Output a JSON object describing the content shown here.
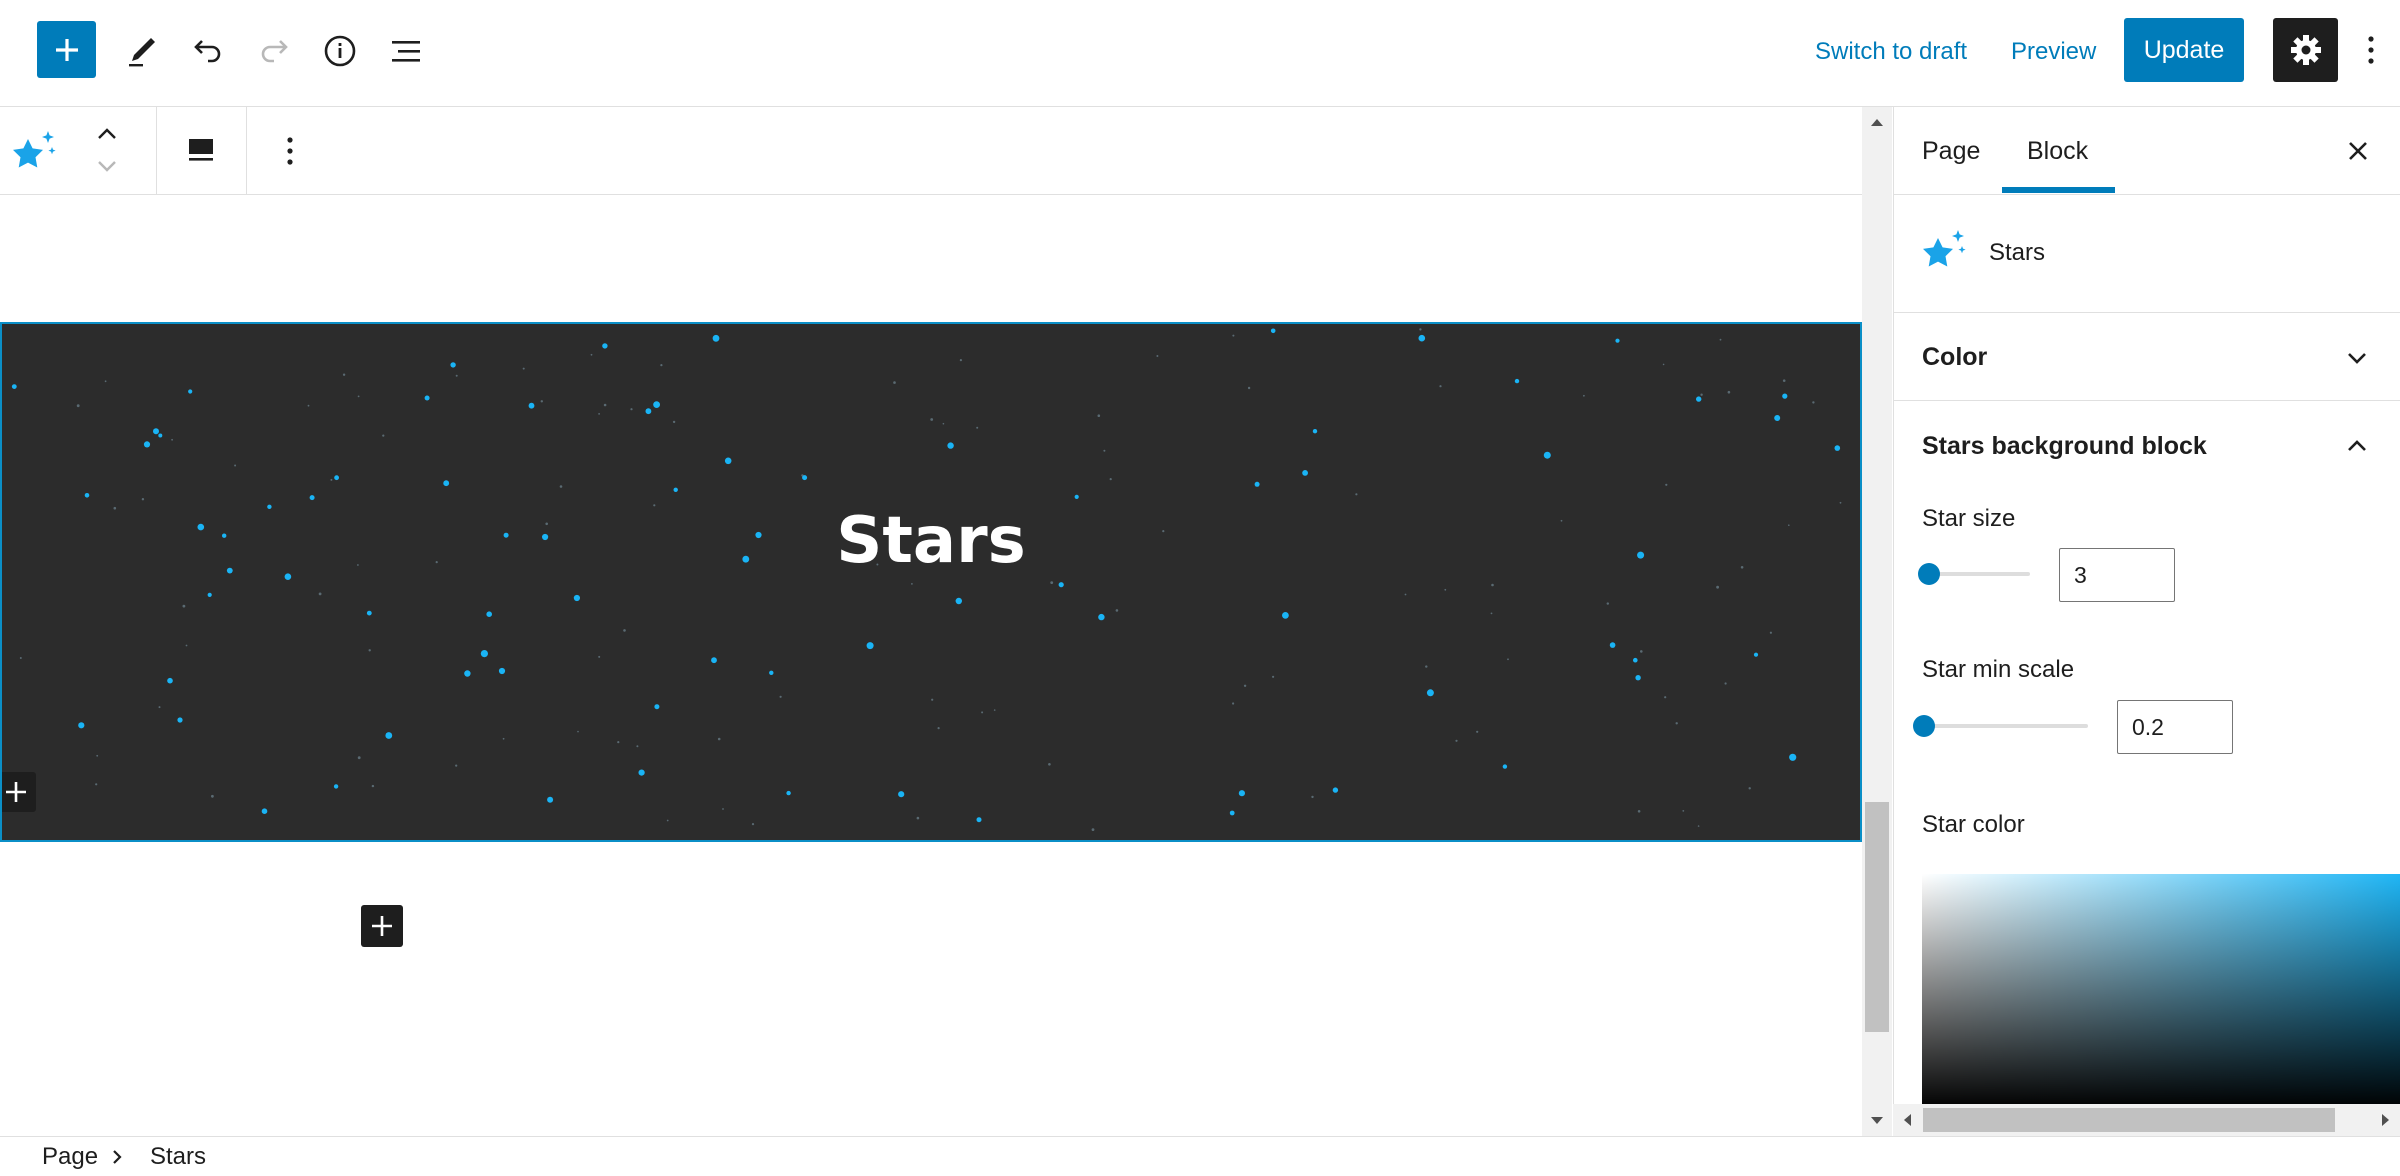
{
  "toolbar": {
    "switch_to_draft": "Switch to draft",
    "preview": "Preview",
    "update": "Update",
    "icons": [
      "plus-icon",
      "pencil-icon",
      "undo-icon",
      "redo-icon",
      "info-icon",
      "list-view-icon",
      "gear-icon",
      "more-vertical-icon"
    ]
  },
  "block_toolbar": {
    "icons": [
      "sparkle-star-icon",
      "chevron-up-icon",
      "chevron-down-icon",
      "align-icon",
      "more-vertical-icon"
    ]
  },
  "canvas": {
    "block_title": "Stars",
    "block_background": "#2c2c2c",
    "star_color": "#1ab4f5",
    "selection_color": "#0b8fc7"
  },
  "sidebar": {
    "tabs": [
      {
        "label": "Page",
        "active": false
      },
      {
        "label": "Block",
        "active": true
      }
    ],
    "block_name": "Stars",
    "panels": {
      "color": {
        "title": "Color",
        "expanded": false
      },
      "stars_bg": {
        "title": "Stars background block",
        "expanded": true,
        "star_size": {
          "label": "Star size",
          "value": "3"
        },
        "star_min_scale": {
          "label": "Star min scale",
          "value": "0.2"
        },
        "star_color": {
          "label": "Star color"
        }
      }
    }
  },
  "breadcrumb": {
    "items": [
      "Page",
      "Stars"
    ]
  },
  "colors": {
    "accent": "#007cba",
    "dark": "#1e1e1e"
  }
}
